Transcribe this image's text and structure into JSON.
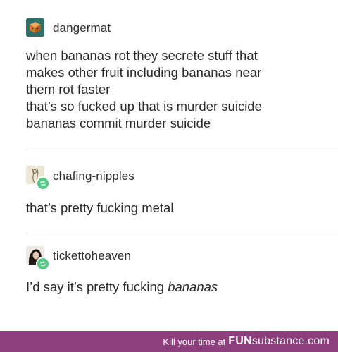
{
  "posts": [
    {
      "username": "dangermat",
      "avatar_icon": "cube-avatar-icon",
      "lines": [
        "when bananas rot they secrete stuff that",
        "makes other fruit including bananas near",
        "them rot faster",
        "that’s so fucked up that is murder suicide",
        "bananas commit murder suicide"
      ]
    },
    {
      "username": "chafing-nipples",
      "avatar_icon": "sketch-avatar-icon",
      "reblog_icon": "reblog-icon",
      "lines": [
        "that’s pretty fucking metal"
      ]
    },
    {
      "username": "tickettoheaven",
      "avatar_icon": "portrait-avatar-icon",
      "reblog_icon": "reblog-icon",
      "text_plain": "I’d say it’s pretty fucking ",
      "text_italic": "bananas"
    }
  ],
  "footer": {
    "tagline": "Kill your time at",
    "brand_bold": "FUN",
    "brand_rest": "substance",
    "brand_suffix": ".com",
    "color": "#8d3e7d"
  },
  "colors": {
    "reblog_badge": "#55c886",
    "avatar_cube": "#2f6f6a"
  }
}
